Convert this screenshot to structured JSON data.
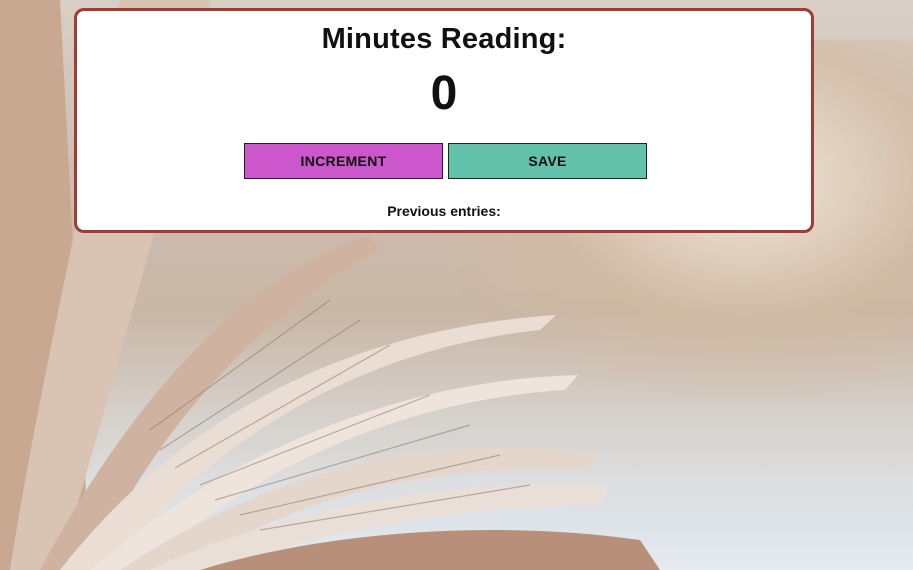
{
  "card": {
    "title": "Minutes Reading:",
    "count": "0",
    "increment_label": "INCREMENT",
    "save_label": "SAVE",
    "entries_label": "Previous entries:"
  },
  "colors": {
    "card_border": "#a33a34",
    "increment_button": "#cc56cc",
    "save_button": "#62c2a9"
  },
  "background": {
    "description_icon": "open-book-photo"
  }
}
